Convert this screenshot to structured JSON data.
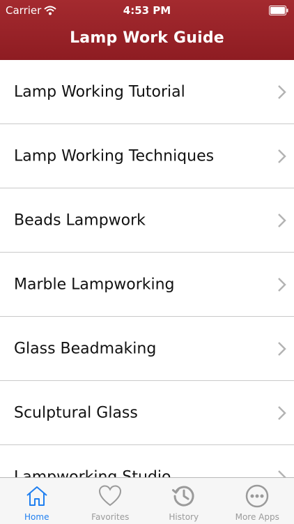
{
  "status_bar": {
    "carrier": "Carrier",
    "time": "4:53 PM"
  },
  "nav": {
    "title": "Lamp Work Guide"
  },
  "list": {
    "items": [
      {
        "label": "Lamp Working Tutorial"
      },
      {
        "label": "Lamp Working Techniques"
      },
      {
        "label": "Beads Lampwork"
      },
      {
        "label": "Marble Lampworking"
      },
      {
        "label": "Glass Beadmaking"
      },
      {
        "label": "Sculptural Glass"
      },
      {
        "label": "Lampworking Studio"
      }
    ]
  },
  "tab_bar": {
    "active_color": "#1f7ff0",
    "inactive_color": "#9a9a9a",
    "tabs": [
      {
        "label": "Home",
        "icon": "home-icon",
        "active": true
      },
      {
        "label": "Favorites",
        "icon": "heart-icon",
        "active": false
      },
      {
        "label": "History",
        "icon": "history-icon",
        "active": false
      },
      {
        "label": "More Apps",
        "icon": "more-icon",
        "active": false
      }
    ]
  },
  "colors": {
    "header_bg": "#9a2228",
    "header_text": "#ffffff",
    "separator": "#c9c9c9",
    "chevron": "#b3b3b3"
  }
}
